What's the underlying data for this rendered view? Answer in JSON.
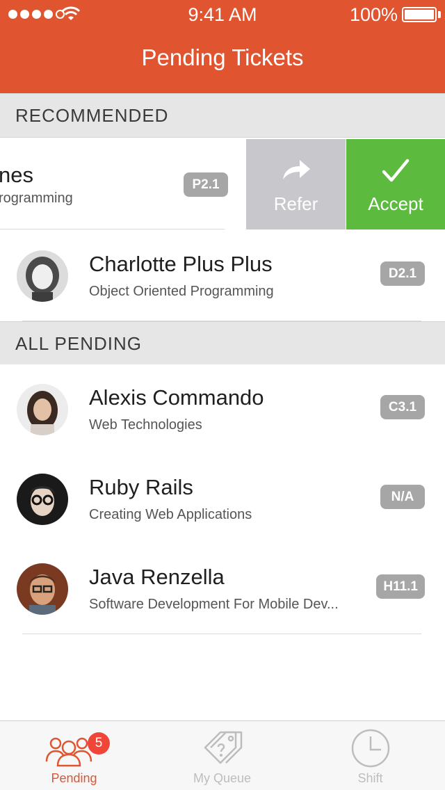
{
  "status_bar": {
    "time": "9:41 AM",
    "battery": "100%"
  },
  "header": {
    "title": "Pending Tickets"
  },
  "sections": {
    "recommended": "RECOMMENDED",
    "all_pending": "ALL PENDING"
  },
  "swiped_row": {
    "name": "nes",
    "course": "rogramming",
    "badge": "P2.1",
    "actions": {
      "refer": "Refer",
      "accept": "Accept"
    },
    "colors": {
      "refer": "#c8c8cc",
      "accept": "#5cbb3f"
    }
  },
  "recommended": [
    {
      "name": "Charlotte Plus Plus",
      "course": "Object Oriented Programming",
      "badge": "D2.1"
    }
  ],
  "pending": [
    {
      "name": "Alexis Commando",
      "course": "Web Technologies",
      "badge": "C3.1"
    },
    {
      "name": "Ruby Rails",
      "course": "Creating Web Applications",
      "badge": "N/A"
    },
    {
      "name": "Java Renzella",
      "course": "Software Development For Mobile Dev...",
      "badge": "H11.1"
    }
  ],
  "tabbar": {
    "pending": {
      "label": "Pending",
      "badge": "5",
      "icon": "users-icon"
    },
    "queue": {
      "label": "My Queue",
      "icon": "tags-icon"
    },
    "shift": {
      "label": "Shift",
      "icon": "clock-icon"
    }
  },
  "colors": {
    "accent": "#e05530",
    "badge": "#a6a6a6",
    "tab_inactive": "#bdbdbd",
    "notification": "#f0463a"
  }
}
